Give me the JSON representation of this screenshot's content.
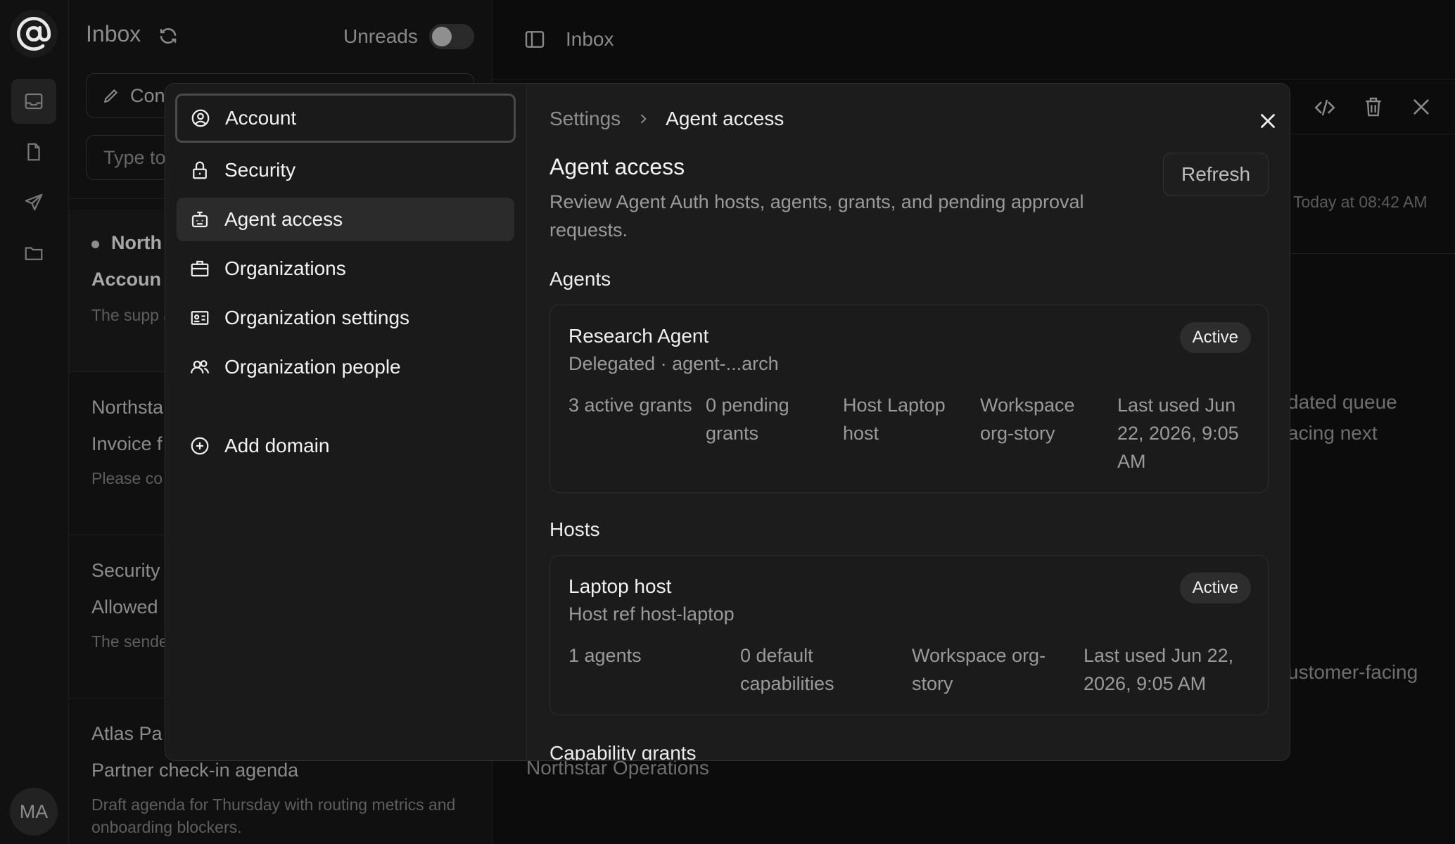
{
  "rail": {
    "logo_icon": "at-sign-icon",
    "items": [
      "inbox-icon",
      "file-icon",
      "send-icon",
      "folder-icon"
    ],
    "avatar_initials": "MA"
  },
  "list": {
    "title": "Inbox",
    "unreads_label": "Unreads",
    "unreads_on": false,
    "compose_label": "Con",
    "search_placeholder": "Type to",
    "items": [
      {
        "sender": "North",
        "subject": "Accoun",
        "preview": "The supp account n"
      },
      {
        "sender": "Northsta",
        "subject": "Invoice f",
        "preview": "Please co the final ir"
      },
      {
        "sender": "Security",
        "subject": "Allowed",
        "preview": "The sende shared su"
      },
      {
        "sender": "Atlas Pa",
        "subject": "Partner check-in agenda",
        "preview": "Draft agenda for Thursday with routing metrics and onboarding blockers."
      }
    ]
  },
  "pane": {
    "title": "Inbox",
    "date": "Today at 08:42 AM",
    "frag1": "dated queue",
    "frag2": "acing next",
    "frag3": "ustomer-facing",
    "footer": "Northstar Operations"
  },
  "modal": {
    "nav": [
      {
        "label": "Account",
        "icon": "user-circle-icon"
      },
      {
        "label": "Security",
        "icon": "lock-icon"
      },
      {
        "label": "Agent access",
        "icon": "bot-icon"
      },
      {
        "label": "Organizations",
        "icon": "briefcase-icon"
      },
      {
        "label": "Organization settings",
        "icon": "id-card-icon"
      },
      {
        "label": "Organization people",
        "icon": "users-icon"
      },
      {
        "label": "Add domain",
        "icon": "plus-circle-icon"
      }
    ],
    "breadcrumb": {
      "root": "Settings",
      "current": "Agent access"
    },
    "heading": "Agent access",
    "description": "Review Agent Auth hosts, agents, grants, and pending approval requests.",
    "refresh_label": "Refresh",
    "agents_label": "Agents",
    "agent": {
      "name": "Research Agent",
      "sub": "Delegated · agent-...arch",
      "status": "Active",
      "stats": [
        "3 active grants",
        "0 pending grants",
        "Host Laptop host",
        "Workspace org-story",
        "Last used Jun 22, 2026, 9:05 AM"
      ]
    },
    "hosts_label": "Hosts",
    "host": {
      "name": "Laptop host",
      "sub": "Host ref host-laptop",
      "status": "Active",
      "stats": [
        "1 agents",
        "0 default capabilities",
        "Workspace org-story",
        "Last used Jun 22, 2026, 9:05 AM"
      ]
    },
    "grants_label": "Capability grants"
  }
}
